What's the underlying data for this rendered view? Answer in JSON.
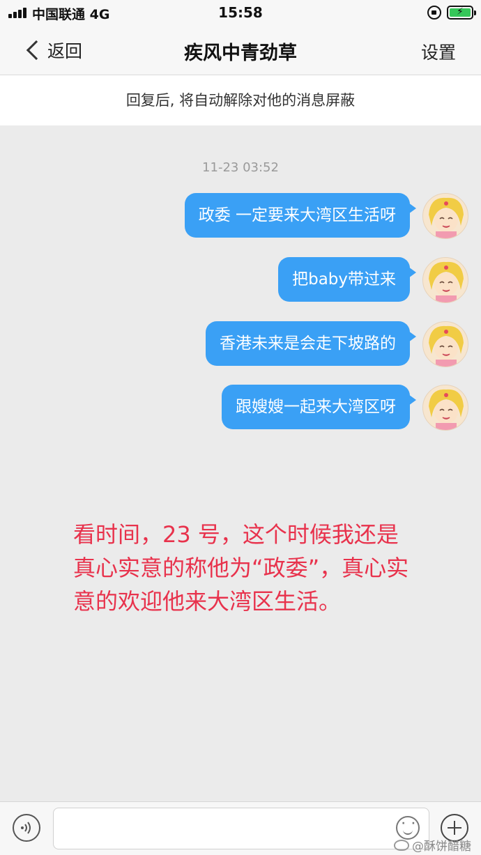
{
  "status_bar": {
    "carrier": "中国联通 4G",
    "time": "15:58"
  },
  "nav": {
    "back_label": "返回",
    "title": "疾风中青劲草",
    "settings_label": "设置"
  },
  "notice": "回复后, 将自动解除对他的消息屏蔽",
  "chat": {
    "timestamp": "11-23 03:52",
    "messages": [
      {
        "text": "政委 一定要来大湾区生活呀"
      },
      {
        "text": "把baby带过来"
      },
      {
        "text": "香港未来是会走下坡路的"
      },
      {
        "text": "跟嫂嫂一起来大湾区呀"
      }
    ]
  },
  "annotation": "看时间，23 号，这个时候我还是真心实意的称他为“政委”，真心实意的欢迎他来大湾区生活。",
  "input_bar": {
    "placeholder": ""
  },
  "watermark": "@酥饼醋糖",
  "colors": {
    "bubble": "#3aa0f5",
    "annotation": "#e8324c",
    "battery": "#35c759"
  }
}
